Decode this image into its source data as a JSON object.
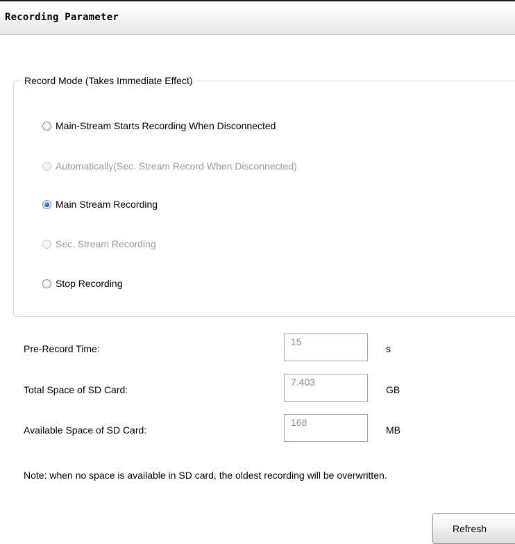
{
  "header": {
    "title": "Recording Parameter"
  },
  "record_mode": {
    "legend": "Record Mode (Takes Immediate Effect)",
    "options": [
      {
        "label": "Main-Stream Starts Recording When Disconnected",
        "checked": false,
        "disabled": false
      },
      {
        "label": "Automatically(Sec. Stream Record When Disconnected)",
        "checked": false,
        "disabled": true
      },
      {
        "label": "Main Stream Recording",
        "checked": true,
        "disabled": false
      },
      {
        "label": "Sec. Stream Recording",
        "checked": false,
        "disabled": true
      },
      {
        "label": "Stop Recording",
        "checked": false,
        "disabled": false
      }
    ]
  },
  "fields": {
    "pre_record": {
      "label": "Pre-Record Time:",
      "value": "15",
      "unit": "s"
    },
    "total_space": {
      "label": "Total Space of SD Card:",
      "value": "7.403",
      "unit": "GB"
    },
    "available_space": {
      "label": "Available Space of SD Card:",
      "value": "168",
      "unit": "MB"
    }
  },
  "note": "Note: when no space is available in SD card, the oldest recording will be overwritten.",
  "refresh_label": "Refresh",
  "colors": {
    "accent_radio": "#2a66a8",
    "disabled_text": "#9b9b9b",
    "group_border": "#d4dde6"
  }
}
